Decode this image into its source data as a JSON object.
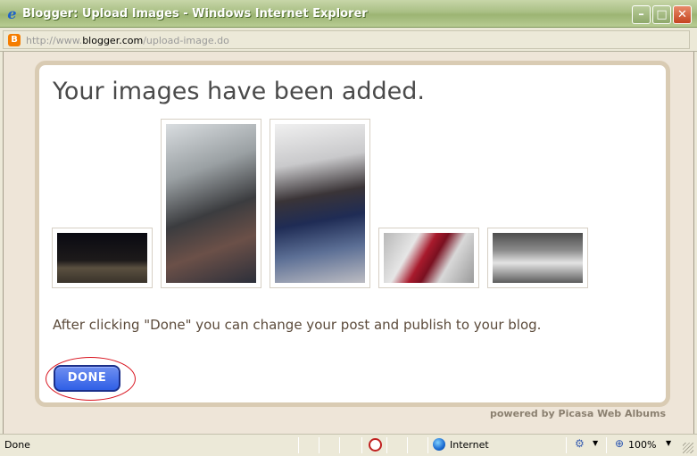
{
  "window": {
    "title": "Blogger: Upload Images - Windows Internet Explorer",
    "ie_icon": "e",
    "minimize": "–",
    "maximize": "□",
    "close": "✕"
  },
  "address": {
    "prefix": "http://www.",
    "host": "blogger.com",
    "path": "/upload-image.do",
    "icon": "B"
  },
  "page": {
    "heading": "Your images have been added.",
    "thumbnails": [
      {
        "name": "night-airport-photo"
      },
      {
        "name": "airplane-cabin-group-photo"
      },
      {
        "name": "airplane-couple-photo"
      },
      {
        "name": "red-passport-documents-photo"
      },
      {
        "name": "white-car-photo"
      }
    ],
    "info": "After clicking \"Done\" you can change your post and publish to your blog.",
    "done_label": "DONE",
    "powered_prefix": "powered by ",
    "powered_brand": "Picasa Web Albums"
  },
  "status": {
    "text": "Done",
    "zone": "Internet",
    "zoom": "100%",
    "dropdown": "▼"
  },
  "colors": {
    "done_button": "#3a66e8",
    "highlight_circle": "#d8111c",
    "panel_border": "#d9cbb3"
  }
}
